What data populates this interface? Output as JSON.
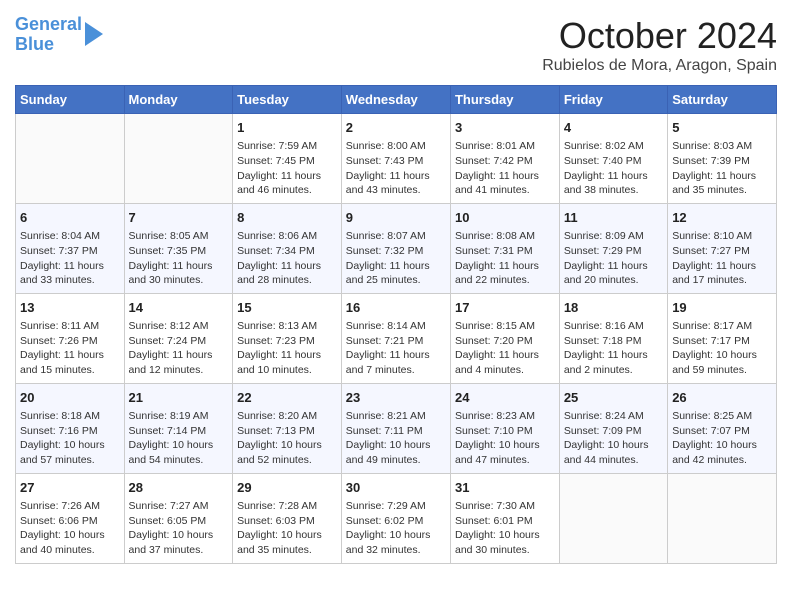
{
  "header": {
    "logo_line1": "General",
    "logo_line2": "Blue",
    "month": "October 2024",
    "location": "Rubielos de Mora, Aragon, Spain"
  },
  "days_of_week": [
    "Sunday",
    "Monday",
    "Tuesday",
    "Wednesday",
    "Thursday",
    "Friday",
    "Saturday"
  ],
  "weeks": [
    [
      {
        "day": null
      },
      {
        "day": null
      },
      {
        "day": "1",
        "sunrise": "Sunrise: 7:59 AM",
        "sunset": "Sunset: 7:45 PM",
        "daylight": "Daylight: 11 hours and 46 minutes."
      },
      {
        "day": "2",
        "sunrise": "Sunrise: 8:00 AM",
        "sunset": "Sunset: 7:43 PM",
        "daylight": "Daylight: 11 hours and 43 minutes."
      },
      {
        "day": "3",
        "sunrise": "Sunrise: 8:01 AM",
        "sunset": "Sunset: 7:42 PM",
        "daylight": "Daylight: 11 hours and 41 minutes."
      },
      {
        "day": "4",
        "sunrise": "Sunrise: 8:02 AM",
        "sunset": "Sunset: 7:40 PM",
        "daylight": "Daylight: 11 hours and 38 minutes."
      },
      {
        "day": "5",
        "sunrise": "Sunrise: 8:03 AM",
        "sunset": "Sunset: 7:39 PM",
        "daylight": "Daylight: 11 hours and 35 minutes."
      }
    ],
    [
      {
        "day": "6",
        "sunrise": "Sunrise: 8:04 AM",
        "sunset": "Sunset: 7:37 PM",
        "daylight": "Daylight: 11 hours and 33 minutes."
      },
      {
        "day": "7",
        "sunrise": "Sunrise: 8:05 AM",
        "sunset": "Sunset: 7:35 PM",
        "daylight": "Daylight: 11 hours and 30 minutes."
      },
      {
        "day": "8",
        "sunrise": "Sunrise: 8:06 AM",
        "sunset": "Sunset: 7:34 PM",
        "daylight": "Daylight: 11 hours and 28 minutes."
      },
      {
        "day": "9",
        "sunrise": "Sunrise: 8:07 AM",
        "sunset": "Sunset: 7:32 PM",
        "daylight": "Daylight: 11 hours and 25 minutes."
      },
      {
        "day": "10",
        "sunrise": "Sunrise: 8:08 AM",
        "sunset": "Sunset: 7:31 PM",
        "daylight": "Daylight: 11 hours and 22 minutes."
      },
      {
        "day": "11",
        "sunrise": "Sunrise: 8:09 AM",
        "sunset": "Sunset: 7:29 PM",
        "daylight": "Daylight: 11 hours and 20 minutes."
      },
      {
        "day": "12",
        "sunrise": "Sunrise: 8:10 AM",
        "sunset": "Sunset: 7:27 PM",
        "daylight": "Daylight: 11 hours and 17 minutes."
      }
    ],
    [
      {
        "day": "13",
        "sunrise": "Sunrise: 8:11 AM",
        "sunset": "Sunset: 7:26 PM",
        "daylight": "Daylight: 11 hours and 15 minutes."
      },
      {
        "day": "14",
        "sunrise": "Sunrise: 8:12 AM",
        "sunset": "Sunset: 7:24 PM",
        "daylight": "Daylight: 11 hours and 12 minutes."
      },
      {
        "day": "15",
        "sunrise": "Sunrise: 8:13 AM",
        "sunset": "Sunset: 7:23 PM",
        "daylight": "Daylight: 11 hours and 10 minutes."
      },
      {
        "day": "16",
        "sunrise": "Sunrise: 8:14 AM",
        "sunset": "Sunset: 7:21 PM",
        "daylight": "Daylight: 11 hours and 7 minutes."
      },
      {
        "day": "17",
        "sunrise": "Sunrise: 8:15 AM",
        "sunset": "Sunset: 7:20 PM",
        "daylight": "Daylight: 11 hours and 4 minutes."
      },
      {
        "day": "18",
        "sunrise": "Sunrise: 8:16 AM",
        "sunset": "Sunset: 7:18 PM",
        "daylight": "Daylight: 11 hours and 2 minutes."
      },
      {
        "day": "19",
        "sunrise": "Sunrise: 8:17 AM",
        "sunset": "Sunset: 7:17 PM",
        "daylight": "Daylight: 10 hours and 59 minutes."
      }
    ],
    [
      {
        "day": "20",
        "sunrise": "Sunrise: 8:18 AM",
        "sunset": "Sunset: 7:16 PM",
        "daylight": "Daylight: 10 hours and 57 minutes."
      },
      {
        "day": "21",
        "sunrise": "Sunrise: 8:19 AM",
        "sunset": "Sunset: 7:14 PM",
        "daylight": "Daylight: 10 hours and 54 minutes."
      },
      {
        "day": "22",
        "sunrise": "Sunrise: 8:20 AM",
        "sunset": "Sunset: 7:13 PM",
        "daylight": "Daylight: 10 hours and 52 minutes."
      },
      {
        "day": "23",
        "sunrise": "Sunrise: 8:21 AM",
        "sunset": "Sunset: 7:11 PM",
        "daylight": "Daylight: 10 hours and 49 minutes."
      },
      {
        "day": "24",
        "sunrise": "Sunrise: 8:23 AM",
        "sunset": "Sunset: 7:10 PM",
        "daylight": "Daylight: 10 hours and 47 minutes."
      },
      {
        "day": "25",
        "sunrise": "Sunrise: 8:24 AM",
        "sunset": "Sunset: 7:09 PM",
        "daylight": "Daylight: 10 hours and 44 minutes."
      },
      {
        "day": "26",
        "sunrise": "Sunrise: 8:25 AM",
        "sunset": "Sunset: 7:07 PM",
        "daylight": "Daylight: 10 hours and 42 minutes."
      }
    ],
    [
      {
        "day": "27",
        "sunrise": "Sunrise: 7:26 AM",
        "sunset": "Sunset: 6:06 PM",
        "daylight": "Daylight: 10 hours and 40 minutes."
      },
      {
        "day": "28",
        "sunrise": "Sunrise: 7:27 AM",
        "sunset": "Sunset: 6:05 PM",
        "daylight": "Daylight: 10 hours and 37 minutes."
      },
      {
        "day": "29",
        "sunrise": "Sunrise: 7:28 AM",
        "sunset": "Sunset: 6:03 PM",
        "daylight": "Daylight: 10 hours and 35 minutes."
      },
      {
        "day": "30",
        "sunrise": "Sunrise: 7:29 AM",
        "sunset": "Sunset: 6:02 PM",
        "daylight": "Daylight: 10 hours and 32 minutes."
      },
      {
        "day": "31",
        "sunrise": "Sunrise: 7:30 AM",
        "sunset": "Sunset: 6:01 PM",
        "daylight": "Daylight: 10 hours and 30 minutes."
      },
      {
        "day": null
      },
      {
        "day": null
      }
    ]
  ]
}
